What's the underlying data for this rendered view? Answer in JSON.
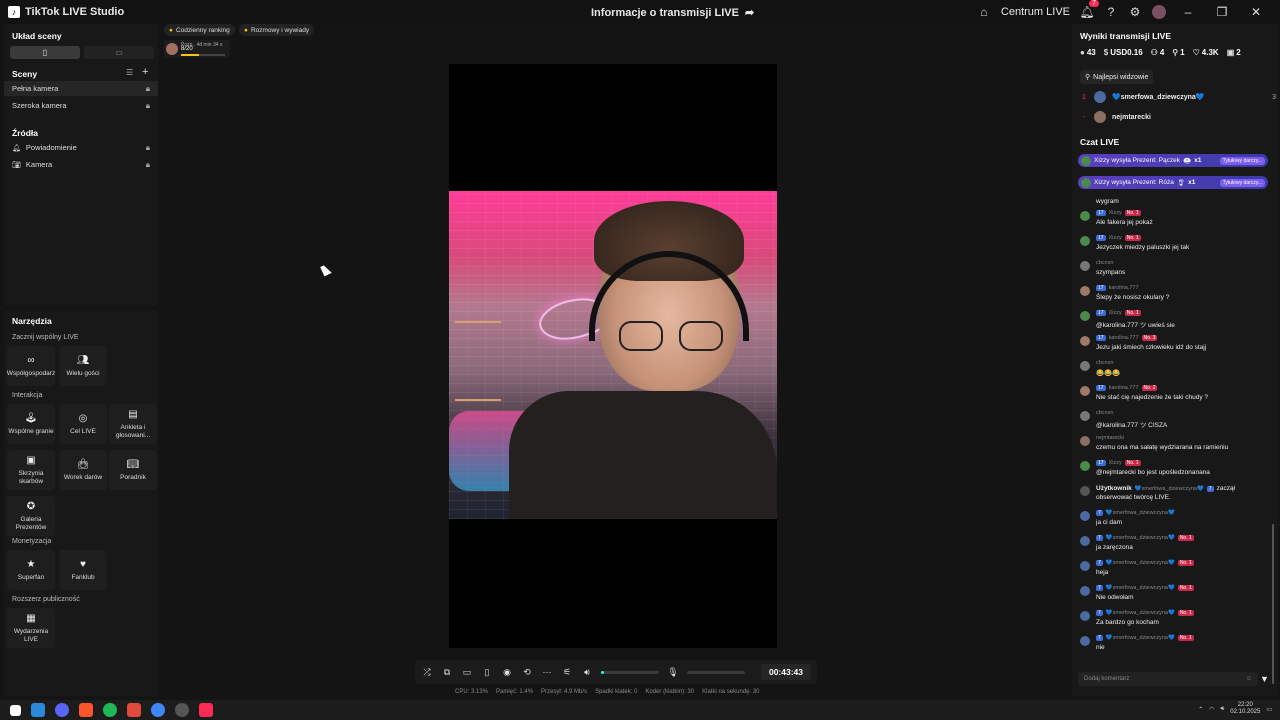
{
  "app": {
    "title": "TikTok LIVE Studio",
    "stream_title": "Informacje o transmisji LIVE"
  },
  "titlebar": {
    "centrum": "Centrum LIVE",
    "notif_count": "7"
  },
  "scene_layout": {
    "title": "Układ sceny"
  },
  "scenes": {
    "title": "Sceny",
    "items": [
      {
        "label": "Pełna kamera"
      },
      {
        "label": "Szeroka kamera"
      }
    ]
  },
  "sources": {
    "title": "Źródła",
    "items": [
      {
        "label": "Powiadomienie"
      },
      {
        "label": "Kamera"
      }
    ]
  },
  "tools": {
    "title": "Narzędzia",
    "group_live": "Zacznij wspólny LIVE",
    "cohost": "Współgospodarz",
    "multiguest": "Wielu gości",
    "group_interaction": "Interakcja",
    "wspolne": "Wspólne granie",
    "cel": "Cel LIVE",
    "ankieta": "Ankieta i głosowani...",
    "skrzynia": "Skrzynia skarbów",
    "worek": "Worek darów",
    "poradnik": "Poradnik",
    "galeria": "Galeria Prezentów",
    "group_monet": "Monetyzacja",
    "superfan": "Superfan",
    "fanklub": "Fanklub",
    "group_reach": "Rozszerz publiczność",
    "wydarzenia": "Wydarzenia LIVE"
  },
  "overlays": {
    "ranking_chip": "Codzienny ranking",
    "talks_chip": "Rozmowy i wywiady",
    "ranking_time": "Pozo.. 4d min 34 s",
    "ranking_value": "8/20",
    "ranking_progress": 0.4
  },
  "controls": {
    "timer": "00:43:43",
    "volume_level": 0.05,
    "mic_level": 0.0
  },
  "stats": {
    "cpu": "CPU: 3.13%",
    "memory": "Pamięć: 1.4%",
    "bitrate": "Przesył: 4.9 Mb/s",
    "dropped": "Spadki klatek: 0",
    "encoder": "Koder (klatkin): 30",
    "fps": "Klatki na sekundę: 30"
  },
  "results": {
    "title": "Wyniki transmisji LIVE",
    "coins": "43",
    "usd": "USD0.16",
    "viewers": "4",
    "follows": "1",
    "likes": "4.3K",
    "gifts": "2",
    "top_viewers_btn": "Najlepsi widzowie",
    "top_viewers": [
      {
        "rank": "1",
        "name": "💙smerfowa_dziewczyna💙",
        "score": "3"
      },
      {
        "rank": "-",
        "name": "nejmtarecki",
        "score": ""
      }
    ]
  },
  "chat": {
    "title": "Czat LIVE",
    "gifts": [
      {
        "text": "Xizzy wysyła Prezent: Pączek",
        "count": "x1",
        "tag": "Tytułowy darczy..."
      },
      {
        "text": "Xizzy wysyła Prezent: Róża",
        "count": "x1",
        "tag": "Tytułowy darczy..."
      }
    ],
    "partial_top": "wygram",
    "messages": [
      {
        "lvl": "17",
        "user": "Xizzy",
        "badge": "No. 1",
        "text": "Ale fakera jej pokaż"
      },
      {
        "lvl": "17",
        "user": "Xizzy",
        "badge": "No. 1",
        "text": "Jezyczek miedzy paluszki jej tak"
      },
      {
        "lvl": "",
        "user": "cbcnxn",
        "badge": "",
        "text": "szympans"
      },
      {
        "lvl": "17",
        "user": "karolina.777",
        "badge": "",
        "text": "Ślepy że nosisz okulary ?"
      },
      {
        "lvl": "17",
        "user": "Xizzy",
        "badge": "No. 1",
        "text": "@karolina.777 ツ uwieś sie"
      },
      {
        "lvl": "17",
        "user": "karolina.777",
        "badge": "No. 3",
        "text": "Jezu jaki śmiech człowieku idź do stajj"
      },
      {
        "lvl": "",
        "user": "cbcnxn",
        "badge": "",
        "text": "😂😂😂"
      },
      {
        "lvl": "17",
        "user": "karolina.777",
        "badge": "No. 2",
        "text": "Nie stać cię najedzenie że taki chudy ?"
      },
      {
        "lvl": "",
        "user": "cbcnxn",
        "badge": "",
        "text": "@karolina.777 ツ CISZA"
      },
      {
        "lvl": "",
        "user": "nejmtarecki",
        "badge": "",
        "text": "czemu ona ma sałatę wydziarana na ramieniu"
      },
      {
        "lvl": "17",
        "user": "Xizzy",
        "badge": "No. 1",
        "text": "@nejmtarecki bo jest upośledzonanana"
      }
    ],
    "system_msg": {
      "user": "Użytkownik",
      "name": "💙smerfowa_dziewczyna💙",
      "lvl": "7",
      "text1": "zaczął",
      "text2": "obserwować twórcę LIVE."
    },
    "messages2": [
      {
        "lvl": "7",
        "user": "💙smerfowa_dziewczyna💙",
        "badge": "",
        "text": "ja ci dam"
      },
      {
        "lvl": "7",
        "user": "💙smerfowa_dziewczyna💙",
        "badge": "No. 1",
        "text": "ja zaręczona"
      },
      {
        "lvl": "7",
        "user": "💙smerfowa_dziewczyna💙",
        "badge": "No. 1",
        "text": "heja"
      },
      {
        "lvl": "7",
        "user": "💙smerfowa_dziewczyna💙",
        "badge": "No. 1",
        "text": "Nie odwołam"
      },
      {
        "lvl": "7",
        "user": "💙smerfowa_dziewczyna💙",
        "badge": "No. 1",
        "text": "Za bardzo go kocham"
      },
      {
        "lvl": "7",
        "user": "💙smerfowa_dziewczyna💙",
        "badge": "No. 1",
        "text": "nie"
      }
    ],
    "comment_placeholder": "Dodaj komentarz"
  },
  "taskbar": {
    "time": "22:20",
    "date": "02.10.2025"
  },
  "colors": {
    "accent": "#fe2c55",
    "cyan": "#25f4ee",
    "gift": "#5a3fbf"
  }
}
